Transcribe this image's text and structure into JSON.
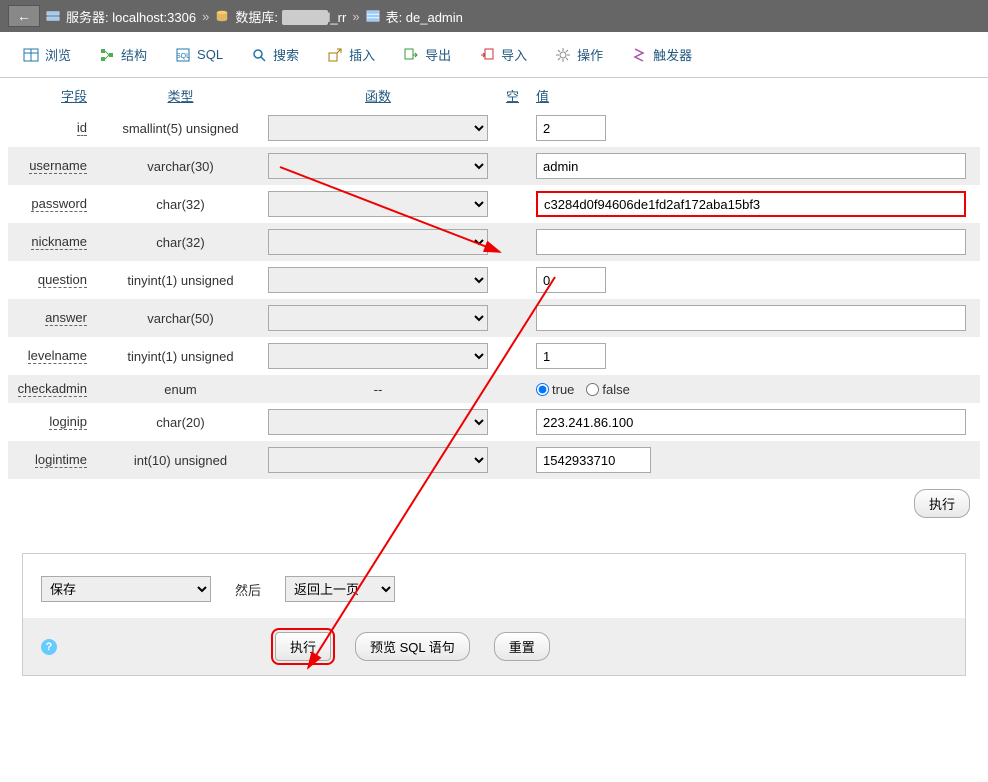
{
  "breadcrumb": {
    "server_label": "服务器: localhost:3306",
    "db_label_prefix": "数据库: ",
    "db_obscured": true,
    "db_suffix": "l_rr",
    "table_label": "表: de_admin"
  },
  "toolbar": {
    "browse": "浏览",
    "structure": "结构",
    "sql": "SQL",
    "search": "搜索",
    "insert": "插入",
    "export": "导出",
    "import": "导入",
    "operations": "操作",
    "triggers": "触发器"
  },
  "headers": {
    "field": "字段",
    "type": "类型",
    "function": "函数",
    "null": "空",
    "value": "值"
  },
  "rows": [
    {
      "field": "id",
      "type": "smallint(5) unsigned",
      "func": "",
      "value": "2",
      "input": "small"
    },
    {
      "field": "username",
      "type": "varchar(30)",
      "func": "",
      "value": "admin",
      "input": "wide"
    },
    {
      "field": "password",
      "type": "char(32)",
      "func": "",
      "value": "c3284d0f94606de1fd2af172aba15bf3",
      "input": "wide",
      "highlight": true
    },
    {
      "field": "nickname",
      "type": "char(32)",
      "func": "",
      "value": "",
      "input": "wide"
    },
    {
      "field": "question",
      "type": "tinyint(1) unsigned",
      "func": "",
      "value": "0",
      "input": "small"
    },
    {
      "field": "answer",
      "type": "varchar(50)",
      "func": "",
      "value": "",
      "input": "wide"
    },
    {
      "field": "levelname",
      "type": "tinyint(1) unsigned",
      "func": "",
      "value": "1",
      "input": "small"
    },
    {
      "field": "checkadmin",
      "type": "enum",
      "func": "--",
      "value": "radio",
      "radio_true": "true",
      "radio_false": "false",
      "radio_checked": "true"
    },
    {
      "field": "loginip",
      "type": "char(20)",
      "func": "",
      "value": "223.241.86.100",
      "input": "wide"
    },
    {
      "field": "logintime",
      "type": "int(10) unsigned",
      "func": "",
      "value": "1542933710",
      "input": "mid"
    }
  ],
  "execute_btn": "执行",
  "bottom": {
    "save_select": "保存",
    "then_label": "然后",
    "goback_select": "返回上一页",
    "exec_btn": "执行",
    "preview_btn": "预览 SQL 语句",
    "reset_btn": "重置"
  }
}
